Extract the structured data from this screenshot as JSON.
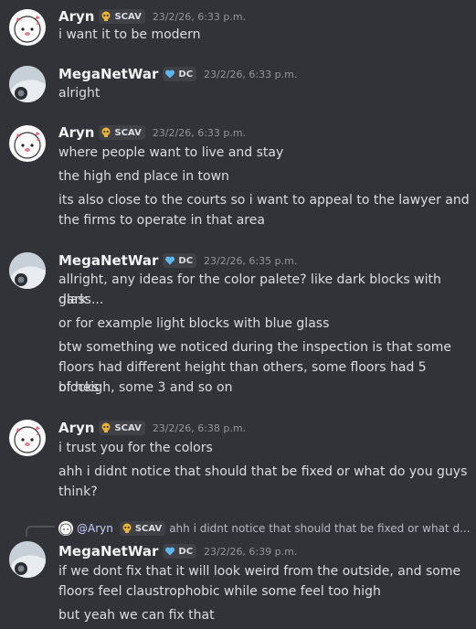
{
  "messages": [
    {
      "user": "Aryn",
      "tag": "SCAV",
      "time": "23/2/26, 6:33 p.m.",
      "lines": [
        "i want it to be modern"
      ]
    },
    {
      "user": "MegaNetWar",
      "tag": "DC",
      "time": "23/2/26, 6:33 p.m.",
      "lines": [
        "alright"
      ]
    },
    {
      "user": "Aryn",
      "tag": "SCAV",
      "time": "23/2/26, 6:33 p.m.",
      "lines": [
        "where people want to live and stay",
        "the high end place in town",
        "its also close to the courts so i want to appeal to the lawyer and",
        "the firms to operate in that area"
      ]
    },
    {
      "user": "MegaNetWar",
      "tag": "DC",
      "time": "23/2/26, 6:35 p.m.",
      "lines": [
        "allright, any ideas for the color palete? like dark blocks with dark",
        "glass...",
        "or for example light blocks with blue glass",
        "btw something we noticed during the inspection is that some",
        "floors had different height than others, some floors had 5 blocks",
        "of heigh, some 3 and so on"
      ]
    },
    {
      "user": "Aryn",
      "tag": "SCAV",
      "time": "23/2/26, 6:38 p.m.",
      "lines": [
        "i trust you for the colors",
        "ahh i didnt notice that should that be fixed or what do you guys",
        "think?"
      ]
    },
    {
      "user": "MegaNetWar",
      "tag": "DC",
      "time": "23/2/26, 6:39 p.m.",
      "lines": [
        "if we dont fix that it will look weird from the outside, and some",
        "floors feel claustrophobic while some feel too high",
        "but yeah we can fix that"
      ]
    }
  ],
  "reply": {
    "mention": "@Aryn",
    "tag": "SCAV",
    "text": "ahh i didnt notice that should that be fixed or what d..."
  },
  "colors": {
    "background": "#323339",
    "name": "#f2f3f5",
    "text": "#dbdee1",
    "timestamp": "#94959c",
    "mention": "#c9cdfb"
  },
  "icons": {
    "scav_tag": "skull-icon",
    "dc_tag": "heart-icon"
  }
}
